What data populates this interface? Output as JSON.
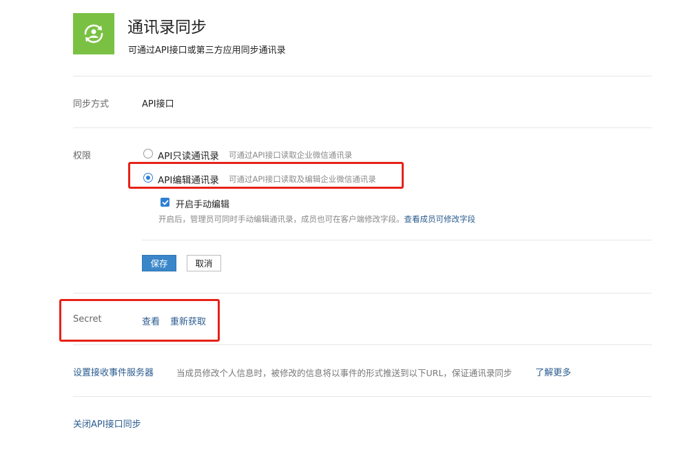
{
  "header": {
    "title": "通讯录同步",
    "subtitle": "可通过API接口或第三方应用同步通讯录"
  },
  "sync_mode": {
    "label": "同步方式",
    "value": "API接口"
  },
  "permissions": {
    "label": "权限",
    "options": [
      {
        "label": "API只读通讯录",
        "desc": "可通过API接口读取企业微信通讯录",
        "selected": false
      },
      {
        "label": "API编辑通讯录",
        "desc": "可通过API接口读取及编辑企业微信通讯录",
        "selected": true
      }
    ],
    "manual_edit": {
      "label": "开启手动编辑",
      "checked": true,
      "hint": "开启后，管理员可同时手动编辑通讯录，成员也可在客户端修改字段。",
      "hint_link": "查看成员可修改字段"
    },
    "save_label": "保存",
    "cancel_label": "取消"
  },
  "secret": {
    "label": "Secret",
    "view_label": "查看",
    "refresh_label": "重新获取"
  },
  "event_server": {
    "label": "设置接收事件服务器",
    "desc": "当成员修改个人信息时，被修改的信息将以事件的形式推送到以下URL，保证通讯录同步",
    "learn_more": "了解更多"
  },
  "close_sync": {
    "label": "关闭API接口同步"
  },
  "colors": {
    "accent": "#2d7fd3",
    "icon_bg": "#7ac143",
    "highlight": "#e62117",
    "link": "#2a5b8f"
  },
  "icons": [
    "contacts-sync-icon",
    "checkmark-icon"
  ]
}
